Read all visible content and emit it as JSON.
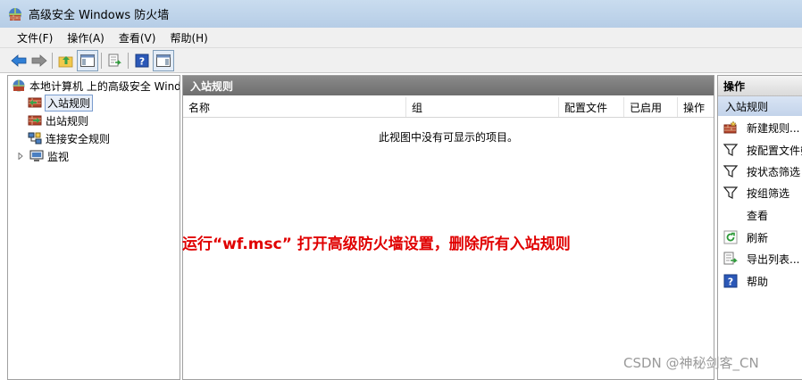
{
  "window": {
    "title": "高级安全 Windows 防火墙"
  },
  "menu": [
    {
      "label": "文件(F)"
    },
    {
      "label": "操作(A)"
    },
    {
      "label": "查看(V)"
    },
    {
      "label": "帮助(H)"
    }
  ],
  "toolbar": {
    "buttons": [
      "back-arrow-icon",
      "forward-arrow-icon",
      "up-folder-icon",
      "show-hide-tree-icon",
      "export-list-icon",
      "help-icon",
      "show-hide-action-pane-icon"
    ]
  },
  "tree": {
    "root": "本地计算机 上的高级安全 Windows 防火墙",
    "items": [
      {
        "label": "入站规则",
        "selected": true
      },
      {
        "label": "出站规则"
      },
      {
        "label": "连接安全规则"
      },
      {
        "label": "监视"
      }
    ]
  },
  "center": {
    "header": "入站规则",
    "columns": [
      "名称",
      "组",
      "配置文件",
      "已启用",
      "操作"
    ],
    "empty_message": "此视图中没有可显示的项目。"
  },
  "actions": {
    "header": "操作",
    "subheader": "入站规则",
    "items": [
      {
        "label": "新建规则...",
        "icon": "new-rule-icon"
      },
      {
        "label": "按配置文件筛选",
        "icon": "filter-icon"
      },
      {
        "label": "按状态筛选",
        "icon": "filter-icon"
      },
      {
        "label": "按组筛选",
        "icon": "filter-icon"
      },
      {
        "label": "查看",
        "icon": ""
      },
      {
        "label": "刷新",
        "icon": "refresh-icon"
      },
      {
        "label": "导出列表...",
        "icon": "export-icon"
      },
      {
        "label": "帮助",
        "icon": "help-icon"
      }
    ]
  },
  "annotation": "运行“wf.msc” 打开高级防火墙设置，删除所有入站规则",
  "watermark": "CSDN @神秘剑客_CN",
  "colors": {
    "annotation": "#e00000",
    "title_bar": "#b6cde6",
    "section_header": "#7a7a7a"
  }
}
